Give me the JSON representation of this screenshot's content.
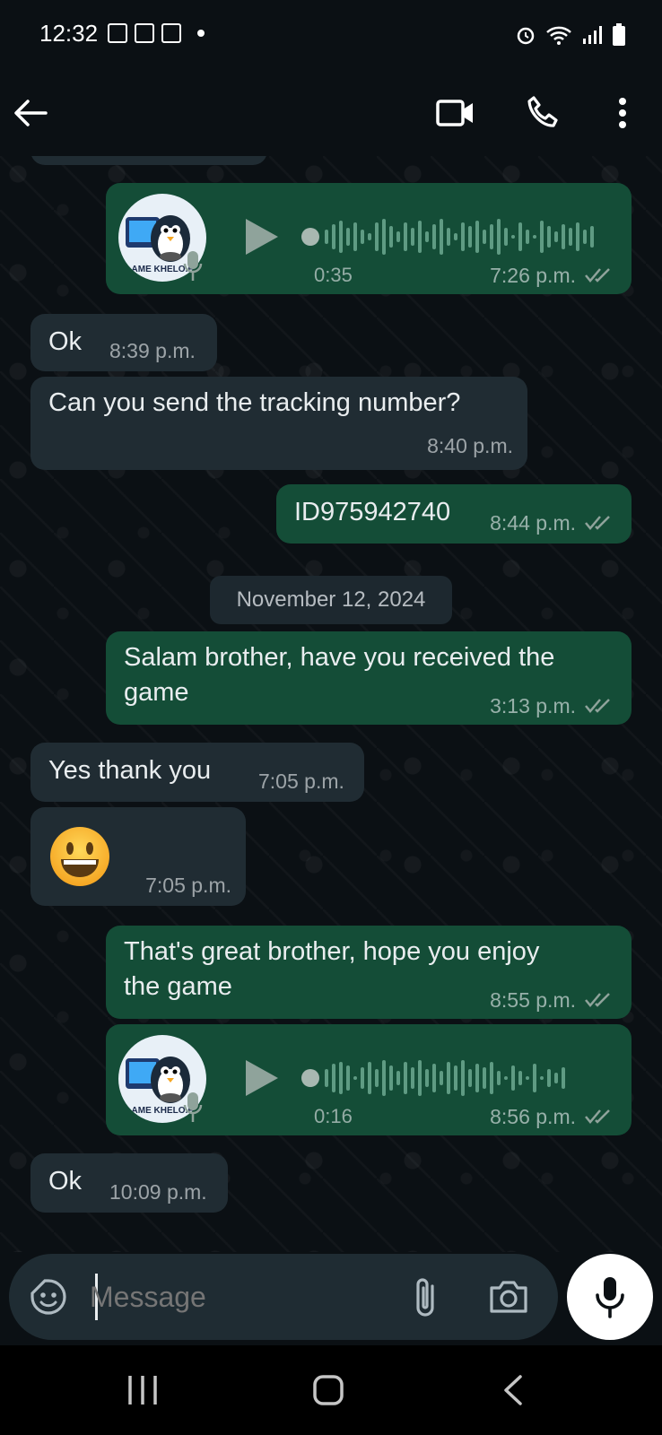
{
  "status_bar": {
    "time": "12:32"
  },
  "chat": {
    "voice_note_1": {
      "avatar_caption": "AME KHELO.F",
      "duration": "0:35",
      "time": "7:26 p.m."
    },
    "msg_ok_1": {
      "text": "Ok",
      "time": "8:39 p.m."
    },
    "msg_tracking": {
      "text": "Can you send the tracking number?",
      "time": "8:40 p.m."
    },
    "msg_id": {
      "text": "ID975942740",
      "time": "8:44 p.m."
    },
    "date_chip": "November 12, 2024",
    "msg_salam": {
      "line1": "Salam brother,  have you received the",
      "line2": "game",
      "time": "3:13 p.m."
    },
    "msg_thanks": {
      "text": "Yes thank you",
      "time": "7:05 p.m."
    },
    "msg_emoji": {
      "time": "7:05 p.m."
    },
    "msg_great": {
      "line1": "That's great brother,  hope you enjoy",
      "line2": "the game",
      "time": "8:55 p.m."
    },
    "voice_note_2": {
      "avatar_caption": "AME KHELO.F",
      "duration": "0:16",
      "time": "8:56 p.m."
    },
    "msg_ok_2": {
      "text": "Ok",
      "time": "10:09 p.m."
    }
  },
  "composer": {
    "placeholder": "Message"
  },
  "colors": {
    "outgoing": "#144d37",
    "incoming": "#202c33",
    "read_ticks": "#8fa39b"
  }
}
